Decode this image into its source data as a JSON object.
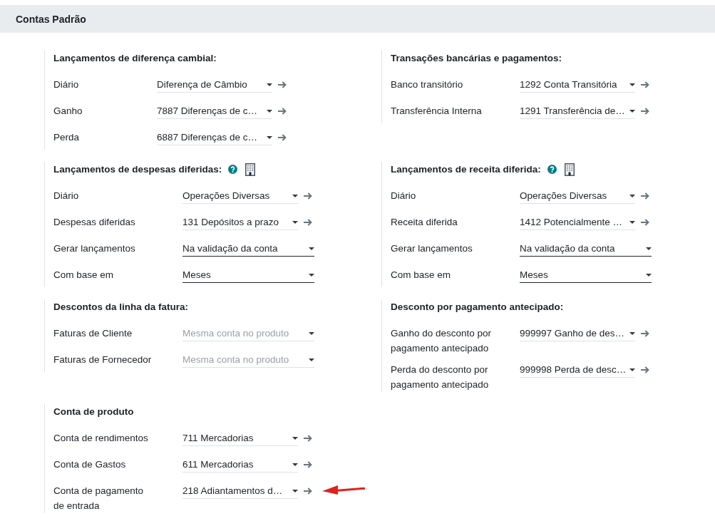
{
  "header": {
    "title": "Contas Padrão"
  },
  "sections": [
    {
      "title": "Lançamentos de diferença cambial:",
      "help": false,
      "company_dependent": false,
      "rows": [
        {
          "label": "Diário",
          "field": {
            "kind": "many2one",
            "value": "Diferença de Câmbio"
          },
          "highlighted": false
        },
        {
          "label": "Ganho",
          "field": {
            "kind": "many2one",
            "value": "7887 Diferenças de c…"
          },
          "highlighted": false
        },
        {
          "label": "Perda",
          "field": {
            "kind": "many2one",
            "value": "6887 Diferenças de c…"
          },
          "highlighted": false
        }
      ]
    },
    {
      "title": "Transações bancárias e pagamentos:",
      "help": false,
      "company_dependent": false,
      "rows": [
        {
          "label": "Banco transitório",
          "field": {
            "kind": "many2one",
            "value": "1292 Conta Transitória"
          },
          "highlighted": false
        },
        {
          "label": "Transferência Interna",
          "field": {
            "kind": "many2one",
            "value": "1291 Transferência de…"
          },
          "highlighted": false
        }
      ]
    },
    {
      "title": "Lançamentos de despesas diferidas:",
      "help": true,
      "company_dependent": true,
      "rows": [
        {
          "label": "Diário",
          "field": {
            "kind": "many2one",
            "value": "Operações Diversas"
          },
          "highlighted": false
        },
        {
          "label": "Despesas diferidas",
          "field": {
            "kind": "many2one",
            "value": "131 Depósitos a prazo"
          },
          "highlighted": false
        },
        {
          "label": "Gerar lançamentos",
          "field": {
            "kind": "selection",
            "value": "Na validação da conta"
          },
          "highlighted": false
        },
        {
          "label": "Com base em",
          "field": {
            "kind": "selection",
            "value": "Meses"
          },
          "highlighted": false
        }
      ]
    },
    {
      "title": "Lançamentos de receita diferida:",
      "help": true,
      "company_dependent": true,
      "rows": [
        {
          "label": "Diário",
          "field": {
            "kind": "many2one",
            "value": "Operações Diversas"
          },
          "highlighted": false
        },
        {
          "label": "Receita diferida",
          "field": {
            "kind": "many2one",
            "value": "1412 Potencialmente …"
          },
          "highlighted": false
        },
        {
          "label": "Gerar lançamentos",
          "field": {
            "kind": "selection",
            "value": "Na validação da conta"
          },
          "highlighted": false
        },
        {
          "label": "Com base em",
          "field": {
            "kind": "selection",
            "value": "Meses"
          },
          "highlighted": false
        }
      ]
    },
    {
      "title": "Descontos da linha da fatura:",
      "help": false,
      "company_dependent": false,
      "rows": [
        {
          "label": "Faturas de Cliente",
          "field": {
            "kind": "many2one",
            "placeholder": "Mesma conta no produto"
          },
          "highlighted": false
        },
        {
          "label": "Faturas de Fornecedor",
          "field": {
            "kind": "many2one",
            "placeholder": "Mesma conta no produto"
          },
          "highlighted": false
        }
      ]
    },
    {
      "title": "Desconto por pagamento antecipado:",
      "help": false,
      "company_dependent": false,
      "rows": [
        {
          "label": "Ganho do desconto por pagamento antecipado",
          "field": {
            "kind": "many2one",
            "value": "999997 Ganho de des…"
          },
          "highlighted": false
        },
        {
          "label": "Perda do desconto por pagamento antecipado",
          "field": {
            "kind": "many2one",
            "value": "999998 Perda de desc…"
          },
          "highlighted": false
        }
      ]
    },
    {
      "title": "Conta de produto",
      "help": false,
      "company_dependent": false,
      "rows": [
        {
          "label": "Conta de rendimentos",
          "field": {
            "kind": "many2one",
            "value": "711 Mercadorias"
          },
          "highlighted": false
        },
        {
          "label": "Conta de Gastos",
          "field": {
            "kind": "many2one",
            "value": "611 Mercadorias"
          },
          "highlighted": false
        },
        {
          "label": "Conta de pagamento de entrada",
          "field": {
            "kind": "many2one",
            "value": "218 Adiantamentos d…"
          },
          "highlighted": true
        }
      ]
    }
  ]
}
